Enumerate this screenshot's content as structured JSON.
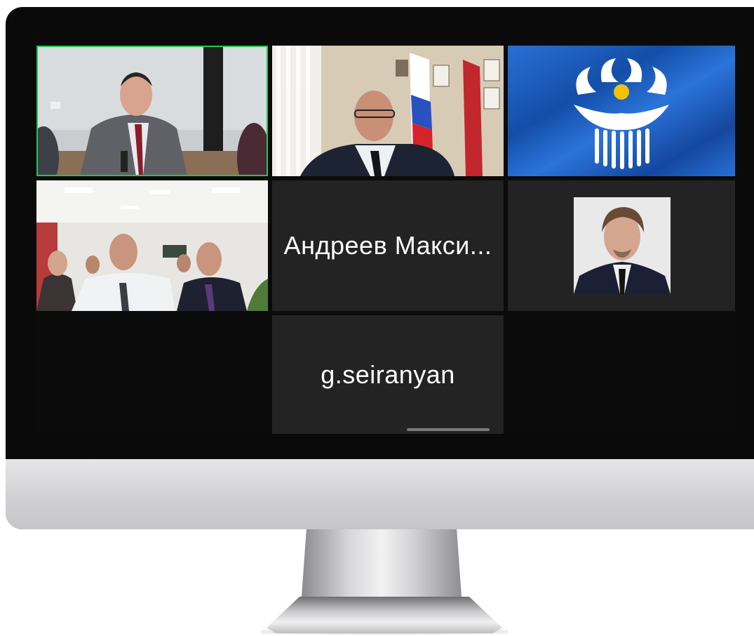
{
  "participants": [
    {
      "id": "p1",
      "type": "video",
      "description": "Meeting room video",
      "active_speaker": true
    },
    {
      "id": "p2",
      "type": "video",
      "description": "Office video with flags"
    },
    {
      "id": "p3",
      "type": "video",
      "description": "CIS emblem flag"
    },
    {
      "id": "p4",
      "type": "video",
      "description": "Group in office"
    },
    {
      "id": "p5",
      "type": "name",
      "name": "Андреев Макси..."
    },
    {
      "id": "p6",
      "type": "photo",
      "description": "Profile photo"
    },
    {
      "id": "p7",
      "type": "name",
      "name": "g.seiranyan"
    }
  ],
  "colors": {
    "active_speaker_border": "#23c552",
    "tile_background": "#232323",
    "screen_background": "#0b0b0b",
    "cis_flag_blue": "#1a5fc4",
    "cis_emblem_white": "#ffffff",
    "cis_emblem_yellow": "#f2c200"
  }
}
